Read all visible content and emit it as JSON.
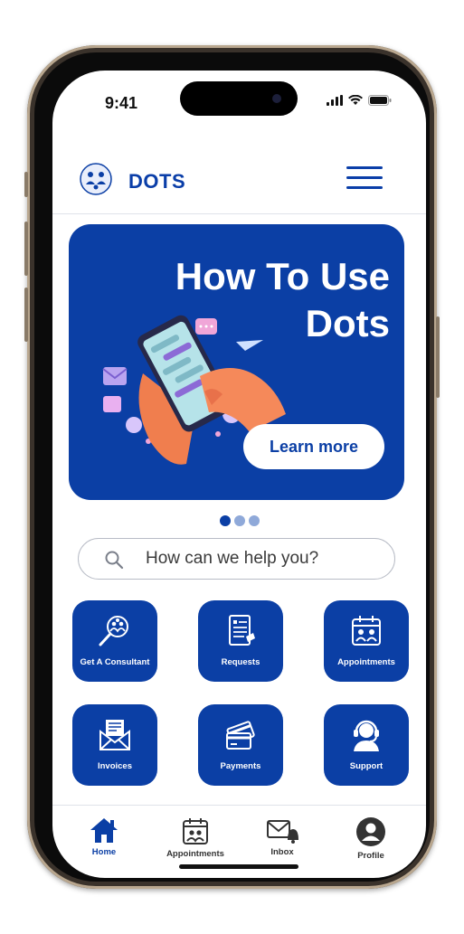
{
  "status_bar": {
    "time": "9:41"
  },
  "header": {
    "app_name": "DOTS"
  },
  "banner": {
    "title_line1": "How To Use",
    "title_line2": "Dots",
    "cta_label": "Learn more",
    "page_count": 3,
    "active_page": 1
  },
  "search": {
    "placeholder": "How can we help you?"
  },
  "services": [
    {
      "label": "Get A Consultant",
      "icon": "consultant-search-icon"
    },
    {
      "label": "Requests",
      "icon": "requests-document-icon"
    },
    {
      "label": "Appointments",
      "icon": "appointments-calendar-icon"
    },
    {
      "label": "Invoices",
      "icon": "invoice-envelope-icon"
    },
    {
      "label": "Payments",
      "icon": "payment-cards-icon"
    },
    {
      "label": "Support",
      "icon": "support-headset-icon"
    }
  ],
  "bottom_nav": [
    {
      "label": "Home",
      "icon": "home-icon",
      "active": true
    },
    {
      "label": "Appointments",
      "icon": "calendar-icon",
      "active": false
    },
    {
      "label": "Inbox",
      "icon": "mail-bell-icon",
      "active": false
    },
    {
      "label": "Profile",
      "icon": "profile-icon",
      "active": false
    }
  ],
  "colors": {
    "primary": "#0b3fa5",
    "dot_inactive": "#8fa9d9",
    "frame": "#3a322b",
    "screen": "#ffffff"
  }
}
